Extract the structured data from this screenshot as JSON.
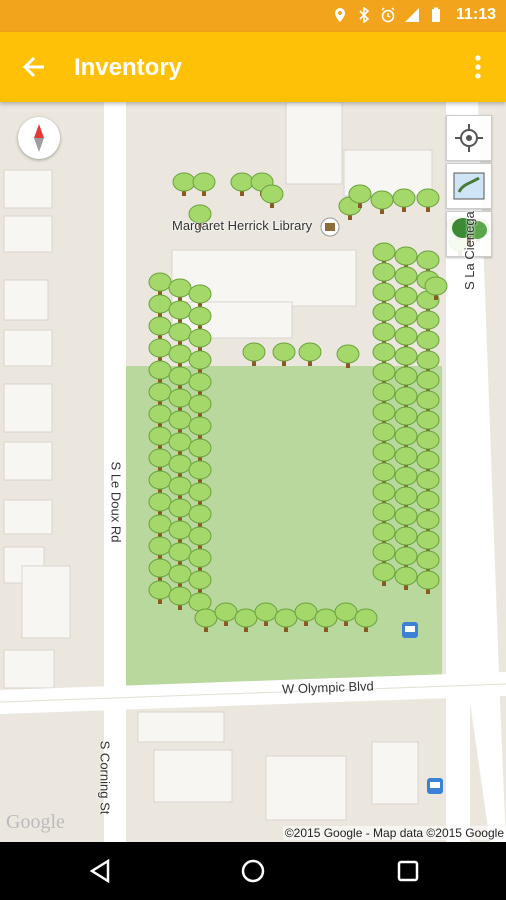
{
  "status_bar": {
    "time": "11:13",
    "icons": [
      "location-icon",
      "bluetooth-icon",
      "alarm-icon",
      "signal-icon",
      "battery-icon"
    ]
  },
  "app_bar": {
    "title": "Inventory"
  },
  "map": {
    "labels": {
      "library": "Margaret Herrick Library",
      "le_doux": "S Le Doux Rd",
      "la_cienega": "S La Cienega",
      "olympic": "W Olympic Blvd",
      "corning": "S Corning St"
    },
    "google_logo": "Google",
    "attribution": "©2015 Google - Map data ©2015 Google"
  },
  "colors": {
    "status_bar": "#f2a51c",
    "app_bar": "#ffc107",
    "park": "#b9d89d",
    "tree_canopy": "#a5d86a",
    "tree_trunk": "#8a5a22"
  }
}
